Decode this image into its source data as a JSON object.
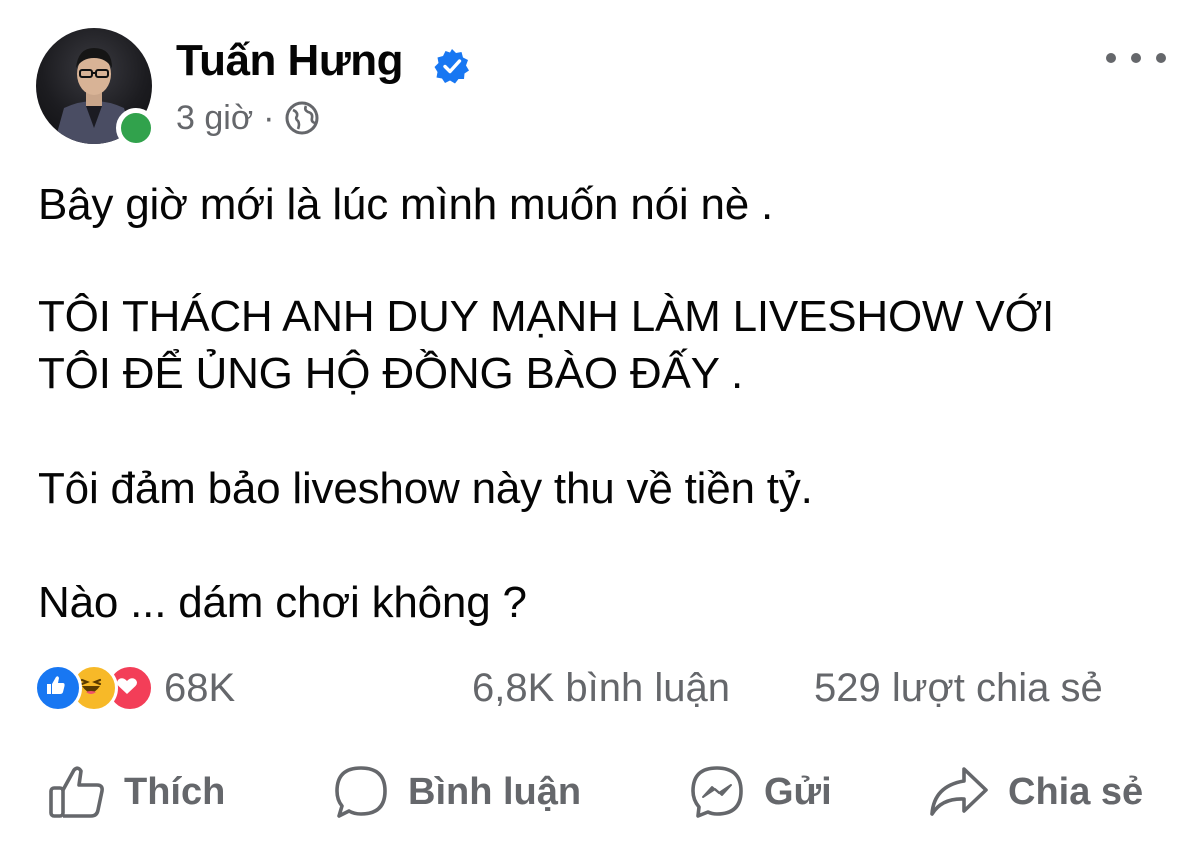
{
  "post": {
    "author": "Tuấn Hưng",
    "time": "3 giờ",
    "separator": "·",
    "paragraphs": {
      "p1": "Bây giờ mới là lúc mình muốn nói nè .",
      "p2_line1": "TÔI THÁCH ANH DUY MẠNH LÀM LIVESHOW VỚI",
      "p2_line2": "TÔI ĐỂ ỦNG HỘ ĐỒNG BÀO ĐẤY .",
      "p3": "Tôi đảm bảo liveshow này thu về tiền tỷ.",
      "p4": "Nào ... dám chơi không ?"
    }
  },
  "stats": {
    "reactions_count": "68K",
    "reaction_types": [
      "like-icon",
      "haha-icon",
      "love-icon"
    ],
    "comments": "6,8K bình luận",
    "shares": "529 lượt chia sẻ"
  },
  "actions": {
    "like": "Thích",
    "comment": "Bình luận",
    "send": "Gửi",
    "share": "Chia sẻ"
  },
  "colors": {
    "brand_blue": "#1877f2",
    "online_green": "#31a24c",
    "secondary_text": "#65676b",
    "love_red": "#f33e58",
    "haha_yellow": "#f7b928"
  }
}
